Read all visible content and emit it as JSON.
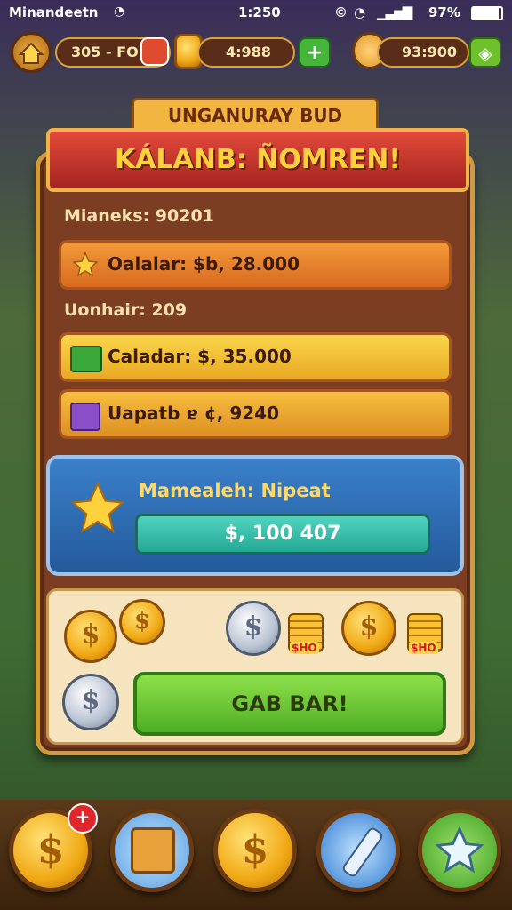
{
  "status_bar": {
    "carrier": "Minandeetn",
    "time": "1:250",
    "battery": "97%"
  },
  "top_bar": {
    "left_value": "305 - FO",
    "center_value": "4:988",
    "right_value": "93:900"
  },
  "banner": {
    "subtitle": "UNGANURAY BUD",
    "title": "KÁLANB: ÑOMREN!"
  },
  "panel": {
    "section1_text": "Mianeks: 90201",
    "row1_label": "Oalalar: $b, 28.000",
    "section2_text": "Uonhair: 209",
    "row2_label": "Caladar: $, 35.000",
    "row3_label": "Uapatb ɐ ¢, 9240",
    "reward_title": "Mamealeh: Nipeat",
    "reward_value": "$, 100 407",
    "cta_label": "GAB BAR!",
    "stack_tag_1": "$HO",
    "stack_tag_2": "$HO"
  },
  "icons": {
    "coin_symbol": "$",
    "badge_symbol": "+"
  },
  "colors": {
    "panel_brown": "#7b3e22",
    "gold_border": "#d29a3a",
    "banner_red": "#c8322a",
    "orange_row": "#e8862c",
    "yellow_row": "#f2c233",
    "blue_card": "#2f6fb8",
    "teal_field": "#2fb8a8",
    "green_button": "#5cc032"
  }
}
